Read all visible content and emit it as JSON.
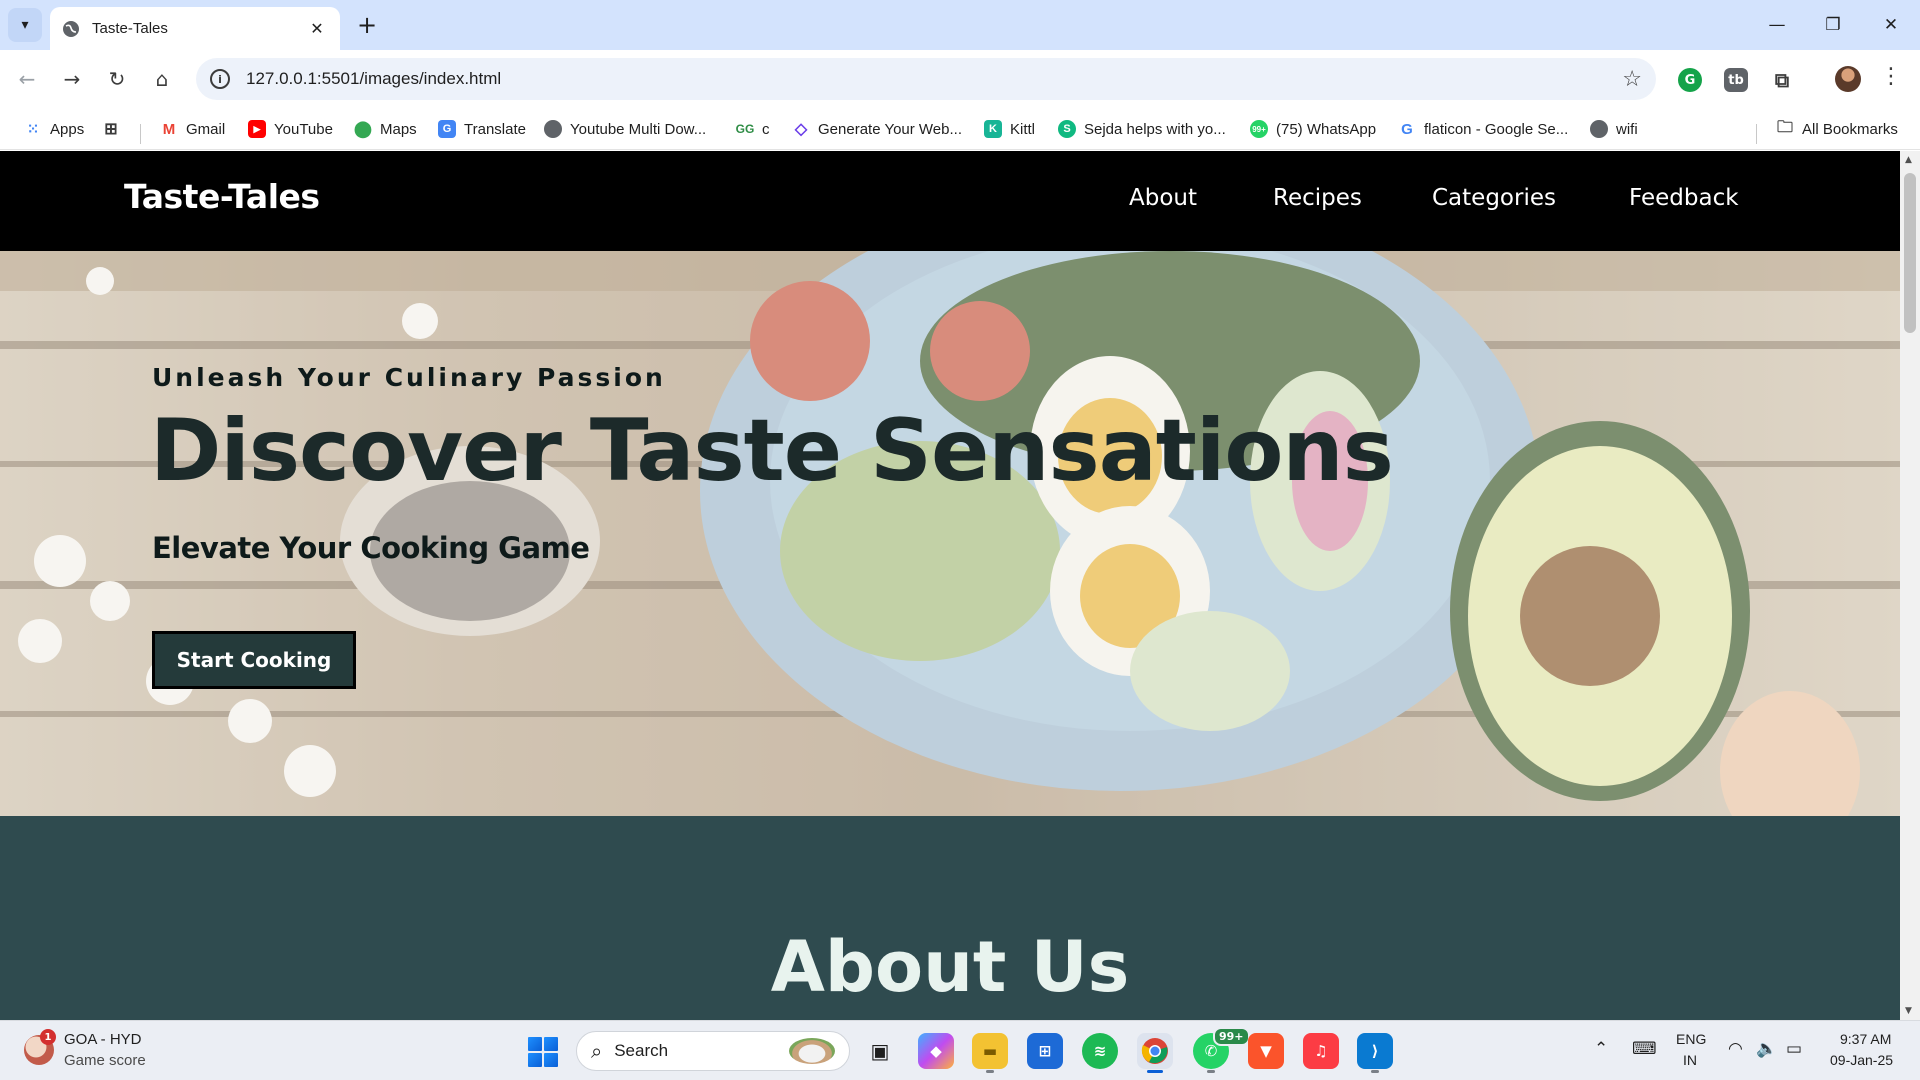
{
  "browser": {
    "tab_title": "Taste-Tales",
    "url": "127.0.0.1:5501/images/index.html",
    "bookmarks": [
      {
        "label": "Apps"
      },
      {
        "label": "Gmail"
      },
      {
        "label": "YouTube"
      },
      {
        "label": "Maps"
      },
      {
        "label": "Translate"
      },
      {
        "label": "Youtube Multi Dow..."
      },
      {
        "label": "c"
      },
      {
        "label": "Generate Your Web..."
      },
      {
        "label": "Kittl"
      },
      {
        "label": "Sejda helps with yo..."
      },
      {
        "label": "(75) WhatsApp"
      },
      {
        "label": "flaticon - Google Se..."
      },
      {
        "label": "wifi"
      }
    ],
    "all_bookmarks": "All Bookmarks"
  },
  "site": {
    "logo": "Taste-Tales",
    "nav": [
      "About",
      "Recipes",
      "Categories",
      "Feedback"
    ],
    "hero": {
      "tagline": "Unleash Your Culinary Passion",
      "headline": "Discover Taste Sensations",
      "subhead": "Elevate Your Cooking Game",
      "cta": "Start Cooking"
    },
    "about_title": "About Us"
  },
  "taskbar": {
    "weather_title": "GOA - HYD",
    "weather_sub": "Game score",
    "weather_badge": "1",
    "search_label": "Search",
    "whatsapp_badge": "99+",
    "lang_top": "ENG",
    "lang_bottom": "IN",
    "time": "9:37 AM",
    "date": "09-Jan-25"
  },
  "colors": {
    "tabbar_bg": "#d3e3fd",
    "site_nav_bg": "#000000",
    "cta_bg": "#243a3a",
    "about_bg": "#2f4b4f",
    "about_title": "#e8f3ee"
  }
}
